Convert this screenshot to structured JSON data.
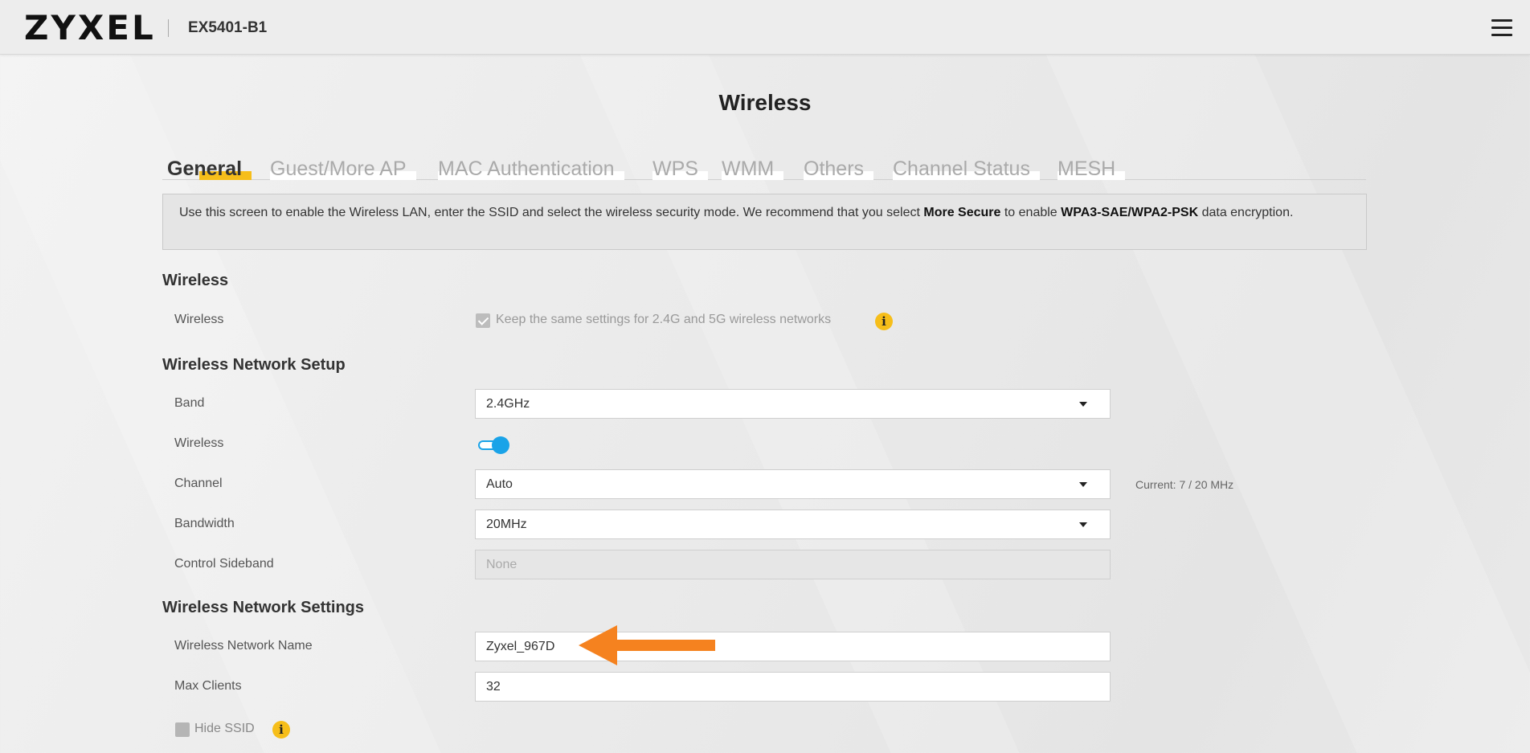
{
  "header": {
    "brand": "ZYXEL",
    "model": "EX5401-B1",
    "menu_icon": "hamburger-menu-icon"
  },
  "page": {
    "title": "Wireless"
  },
  "tabs": [
    {
      "label": "General",
      "active": true
    },
    {
      "label": "Guest/More AP",
      "active": false
    },
    {
      "label": "MAC Authentication",
      "active": false
    },
    {
      "label": "WPS",
      "active": false
    },
    {
      "label": "WMM",
      "active": false
    },
    {
      "label": "Others",
      "active": false
    },
    {
      "label": "Channel Status",
      "active": false
    },
    {
      "label": "MESH",
      "active": false
    }
  ],
  "info": {
    "text_1": "Use this screen to enable the Wireless LAN, enter the SSID and select the wireless security mode. We recommend that you select ",
    "bold_1": "More Secure",
    "text_2": " to enable ",
    "bold_2": "WPA3-SAE/WPA2-PSK",
    "text_3": " data encryption."
  },
  "wireless_section": {
    "heading": "Wireless",
    "row_label": "Wireless",
    "checkbox_label": "Keep the same settings for 2.4G and 5G wireless networks",
    "checkbox_checked": true
  },
  "setup_section": {
    "heading": "Wireless Network Setup",
    "band": {
      "label": "Band",
      "value": "2.4GHz"
    },
    "wireless": {
      "label": "Wireless",
      "enabled": true
    },
    "channel": {
      "label": "Channel",
      "value": "Auto",
      "current": "Current: 7 / 20 MHz"
    },
    "bandwidth": {
      "label": "Bandwidth",
      "value": "20MHz"
    },
    "control_sideband": {
      "label": "Control Sideband",
      "value": "None"
    }
  },
  "settings_section": {
    "heading": "Wireless Network Settings",
    "network_name": {
      "label": "Wireless Network Name",
      "value": "Zyxel_967D"
    },
    "max_clients": {
      "label": "Max Clients",
      "value": "32"
    },
    "hide_ssid": {
      "label": "Hide SSID",
      "checked": false
    }
  },
  "colors": {
    "accent_yellow": "#f6be1a",
    "toggle_blue": "#1aa3e8",
    "annotation_orange": "#f5821f"
  }
}
